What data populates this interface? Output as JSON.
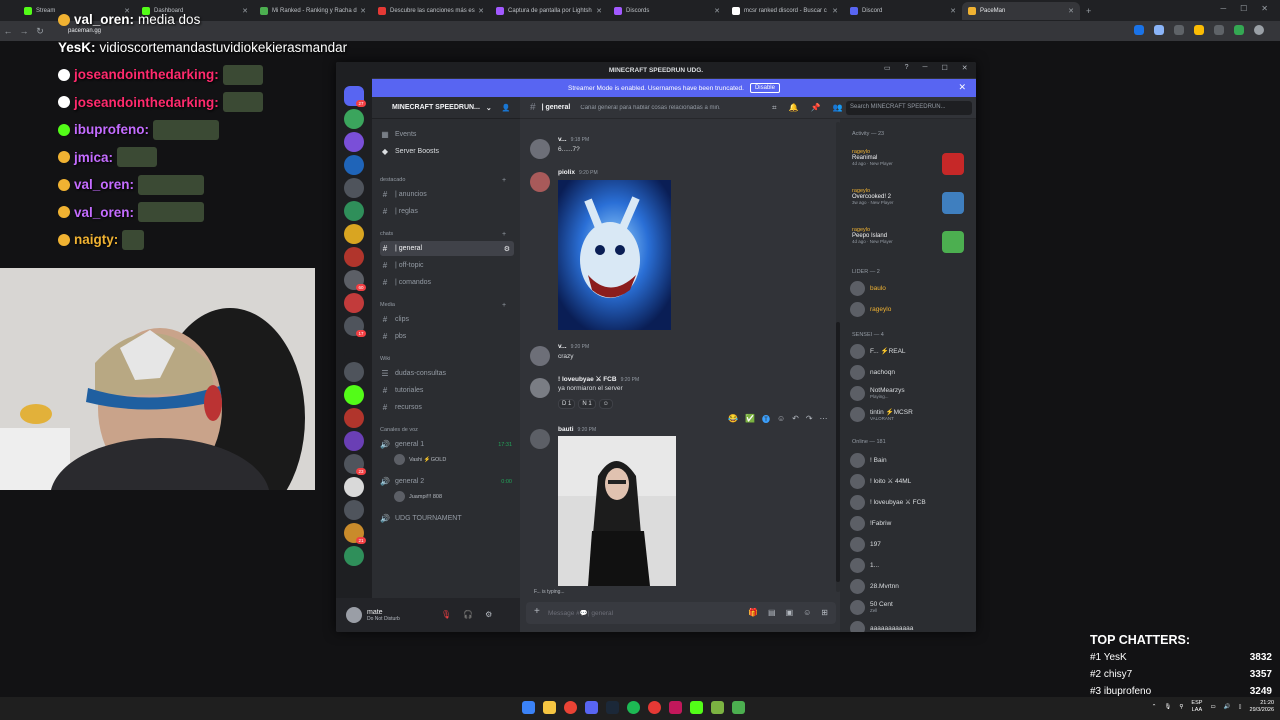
{
  "browser": {
    "tabs": [
      {
        "label": "Stream",
        "color": "#53fc18"
      },
      {
        "label": "Dashboard",
        "color": "#53fc18"
      },
      {
        "label": "Mi Ranked - Ranking y Racha d",
        "color": "#4caf50"
      },
      {
        "label": "Descubre las canciones más es",
        "color": "#e53935"
      },
      {
        "label": "Captura de pantalla por Lightsh",
        "color": "#a259ff"
      },
      {
        "label": "Discords",
        "color": "#a259ff"
      },
      {
        "label": "mcsr ranked discord - Buscar c",
        "color": "#ffffff"
      },
      {
        "label": "Discord",
        "color": "#5865f2"
      },
      {
        "label": "PaceMan",
        "color": "#f0b232",
        "active": true
      }
    ],
    "url": "paceman.gg"
  },
  "stream_chat": [
    {
      "user": "val_oren:",
      "message": "media dos",
      "color": "#ffffff",
      "badge": "#f0b232"
    },
    {
      "user": "YesK:",
      "message": "vidioscortemandastuvidiokekierasmandar",
      "color": "#ffffff",
      "badge": ""
    },
    {
      "user": "joseandointhedarking:",
      "message": "",
      "color": "#ff2a6d",
      "badge": "#ffffff",
      "emote": 40
    },
    {
      "user": "joseandointhedarking:",
      "message": "",
      "color": "#ff2a6d",
      "badge": "#ffffff",
      "emote": 40
    },
    {
      "user": "ibuprofeno:",
      "message": "",
      "color": "#c46cff",
      "badge": "#53fc18",
      "emote": 66
    },
    {
      "user": "jmica:",
      "message": "",
      "color": "#c46cff",
      "badge": "#f0b232",
      "emote": 40
    },
    {
      "user": "val_oren:",
      "message": "",
      "color": "#c46cff",
      "badge": "#f0b232",
      "emote": 66
    },
    {
      "user": "val_oren:",
      "message": "",
      "color": "#c46cff",
      "badge": "#f0b232",
      "emote": 66
    },
    {
      "user": "naigty:",
      "message": "",
      "color": "#f0b232",
      "badge": "#f0b232",
      "emote": 22
    }
  ],
  "discord": {
    "window_title": "MINECRAFT SPEEDRUN UDG.",
    "notice": "Streamer Mode is enabled. Usernames have been truncated.",
    "notice_button": "Disable",
    "server_name": "MINECRAFT SPEEDRUN...",
    "top_items": [
      {
        "label": "Events",
        "icon": "calendar-icon"
      },
      {
        "label": "Server Boosts",
        "icon": "boost-icon"
      }
    ],
    "categories": {
      "destacado": "destacado",
      "chats": "chats",
      "media": "Media",
      "wiki": "Wiki",
      "voice": "Canales de voz"
    },
    "channels": {
      "anuncios": "| anuncios",
      "reglas": "| reglas",
      "general": "| general",
      "offtopic": "| off-topic",
      "comandos": "| comandos",
      "clips": "clips",
      "pbs": "pbs",
      "dudas": "dudas-consultas",
      "tutoriales": "tutoriales",
      "recursos": "recursos",
      "voice1": "general 1",
      "voice1_time": "17:31",
      "voice1_user": "Vashi ⚡GOLD",
      "voice2": "general 2",
      "voice2_time": "0:00",
      "voice2_user": "Juampi!!! 808",
      "tournament": "UDG TOURNAMENT"
    },
    "header": {
      "channel": "| general",
      "topic": "Canal general para hablar cosas relacionadas a min...",
      "search_placeholder": "Search MINECRAFT SPEEDRUN..."
    },
    "messages": [
      {
        "user": "v...",
        "time": "9:18 PM",
        "text": "6......7?"
      },
      {
        "user": "piolix",
        "time": "9:20 PM",
        "text": ""
      },
      {
        "user": "v...",
        "time": "9:20 PM",
        "text": "crazy"
      },
      {
        "user": "! loveubyae ⚔ FCB",
        "time": "9:20 PM",
        "text": "ya normiaron el server"
      },
      {
        "user": "bauti",
        "time": "9:20 PM",
        "text": ""
      }
    ],
    "reactions": [
      "D 1",
      "N 1",
      "☺"
    ],
    "typing": "F... is typing...",
    "composer_placeholder": "Message #💬| general",
    "user": {
      "name": "mate",
      "status": "Do Not Disturb"
    },
    "members": {
      "activity_label": "Activity — 23",
      "activity": [
        {
          "name": "rageylo",
          "game": "Reanimal",
          "sub": "4d ago",
          "tag": "New Player",
          "img": "#c62828"
        },
        {
          "name": "rageylo",
          "game": "Overcooked! 2",
          "sub": "3w ago",
          "tag": "New Player",
          "img": "#3f7fbf"
        },
        {
          "name": "rageylo",
          "game": "Peepo Island",
          "sub": "4d ago",
          "tag": "New Player",
          "img": "#4caf50"
        }
      ],
      "lider_label": "LIDER — 2",
      "lider": [
        {
          "name": "baulo",
          "color": "#f0b232"
        },
        {
          "name": "rageylo",
          "color": "#f0b232"
        }
      ],
      "sensei_label": "SENSEI — 4",
      "sensei": [
        {
          "name": "F... ⚡REAL",
          "sub": ""
        },
        {
          "name": "nachoqn",
          "sub": ""
        },
        {
          "name": "NotMearzys",
          "sub": "Playing..."
        },
        {
          "name": "tintin ⚡MCSR",
          "sub": "VALORANT"
        }
      ],
      "online_label": "Online — 181",
      "online": [
        {
          "name": "! Bain",
          "sub": ""
        },
        {
          "name": "! loito ⚔ 44ML",
          "sub": ""
        },
        {
          "name": "! loveubyae ⚔ FCB",
          "sub": ""
        },
        {
          "name": "!Fabriw",
          "sub": ""
        },
        {
          "name": "197",
          "sub": ""
        },
        {
          "name": "1...",
          "sub": ""
        },
        {
          "name": "28.Mvrtnn",
          "sub": ""
        },
        {
          "name": "50 Cent",
          "sub": "Zell"
        },
        {
          "name": "aaaaaaaaaaaa",
          "sub": ""
        }
      ]
    }
  },
  "top_chatters": {
    "title": "TOP CHATTERS:",
    "rows": [
      {
        "rank": "#1 YesK",
        "count": "3832"
      },
      {
        "rank": "#2 chisy7",
        "count": "3357"
      },
      {
        "rank": "#3 ibuprofeno",
        "count": "3249"
      }
    ]
  },
  "taskbar": {
    "lang": "ESP",
    "lang2": "LAA",
    "time": "21:20",
    "date": "29/3/2026"
  }
}
